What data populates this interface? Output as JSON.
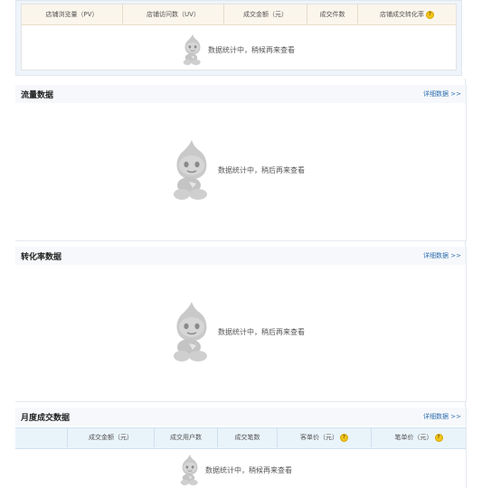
{
  "summary": {
    "columns": [
      "店铺浏览量（PV）",
      "店铺访问数（UV）",
      "成交金额（元）",
      "成交件数",
      "店铺成交转化率"
    ],
    "empty_text": "数据统计中，稍候再来查看"
  },
  "traffic": {
    "title": "流量数据",
    "detail_link": "详细数据 >>",
    "empty_text": "数据统计中，稍后再来查看"
  },
  "conversion": {
    "title": "转化率数据",
    "detail_link": "详细数据 >>",
    "empty_text": "数据统计中，稍后再来查看"
  },
  "monthly": {
    "title": "月度成交数据",
    "detail_link": "详细数据 >>",
    "columns": [
      "",
      "成交金额（元）",
      "成交用户数",
      "成交笔数",
      "客单价（元）",
      "笔单价（元）"
    ],
    "empty_text": "数据统计中，稍候再来查看"
  },
  "icons": {
    "help": "question-mark-icon",
    "mascot": "mascot-placeholder"
  },
  "colors": {
    "link": "#2f6fb0",
    "summary_header": "#fbf6ec",
    "table_header": "#e9f3fa",
    "help_icon": "#f0c419"
  }
}
